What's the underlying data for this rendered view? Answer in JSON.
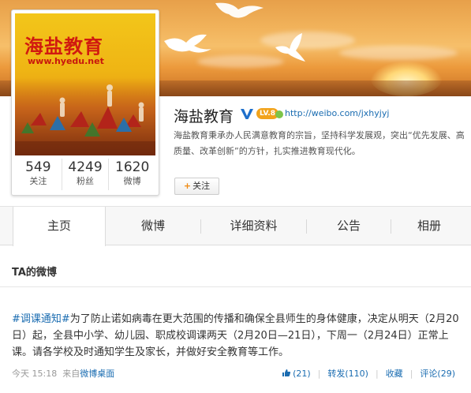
{
  "banner": {
    "background": "#f1b25a"
  },
  "avatar": {
    "logo_title": "海盐教育",
    "logo_url": "www.hyedu.net"
  },
  "stats": [
    {
      "count": "549",
      "label": "关注"
    },
    {
      "count": "4249",
      "label": "粉丝"
    },
    {
      "count": "1620",
      "label": "微博"
    }
  ],
  "profile": {
    "name": "海盐教育",
    "verified_icon": "verified-v-icon",
    "level_badge": "LV.8",
    "url": "http://weibo.com/jxhyjyj",
    "bio": "海盐教育秉承办人民满意教育的宗旨，坚持科学发展观，突出“优先发展、高质量、改革创新”的方针，扎实推进教育现代化。",
    "follow_label": "关注"
  },
  "tabs": [
    {
      "label": "主页",
      "active": true
    },
    {
      "label": "微博"
    },
    {
      "label": "详细资料"
    },
    {
      "label": "公告"
    },
    {
      "label": "相册"
    }
  ],
  "feed": {
    "section_title": "TA的微博",
    "post": {
      "topic": "#调课通知#",
      "text": "为了防止诺如病毒在更大范围的传播和确保全县师生的身体健康，决定从明天（2月20日）起，全县中小学、幼儿园、职成校调课两天（2月20日—21日），下周一（2月24日）正常上课。请各学校及时通知学生及家长，并做好安全教育等工作。",
      "time": "今天 15:18",
      "source_prefix": "来自",
      "source": "微博桌面",
      "likes": "(21)",
      "repost": "转发(110)",
      "favorite": "收藏",
      "comment": "评论(29)"
    }
  },
  "colors": {
    "link": "#1a6cb1",
    "accent": "#f08a12",
    "name": "#222222"
  }
}
